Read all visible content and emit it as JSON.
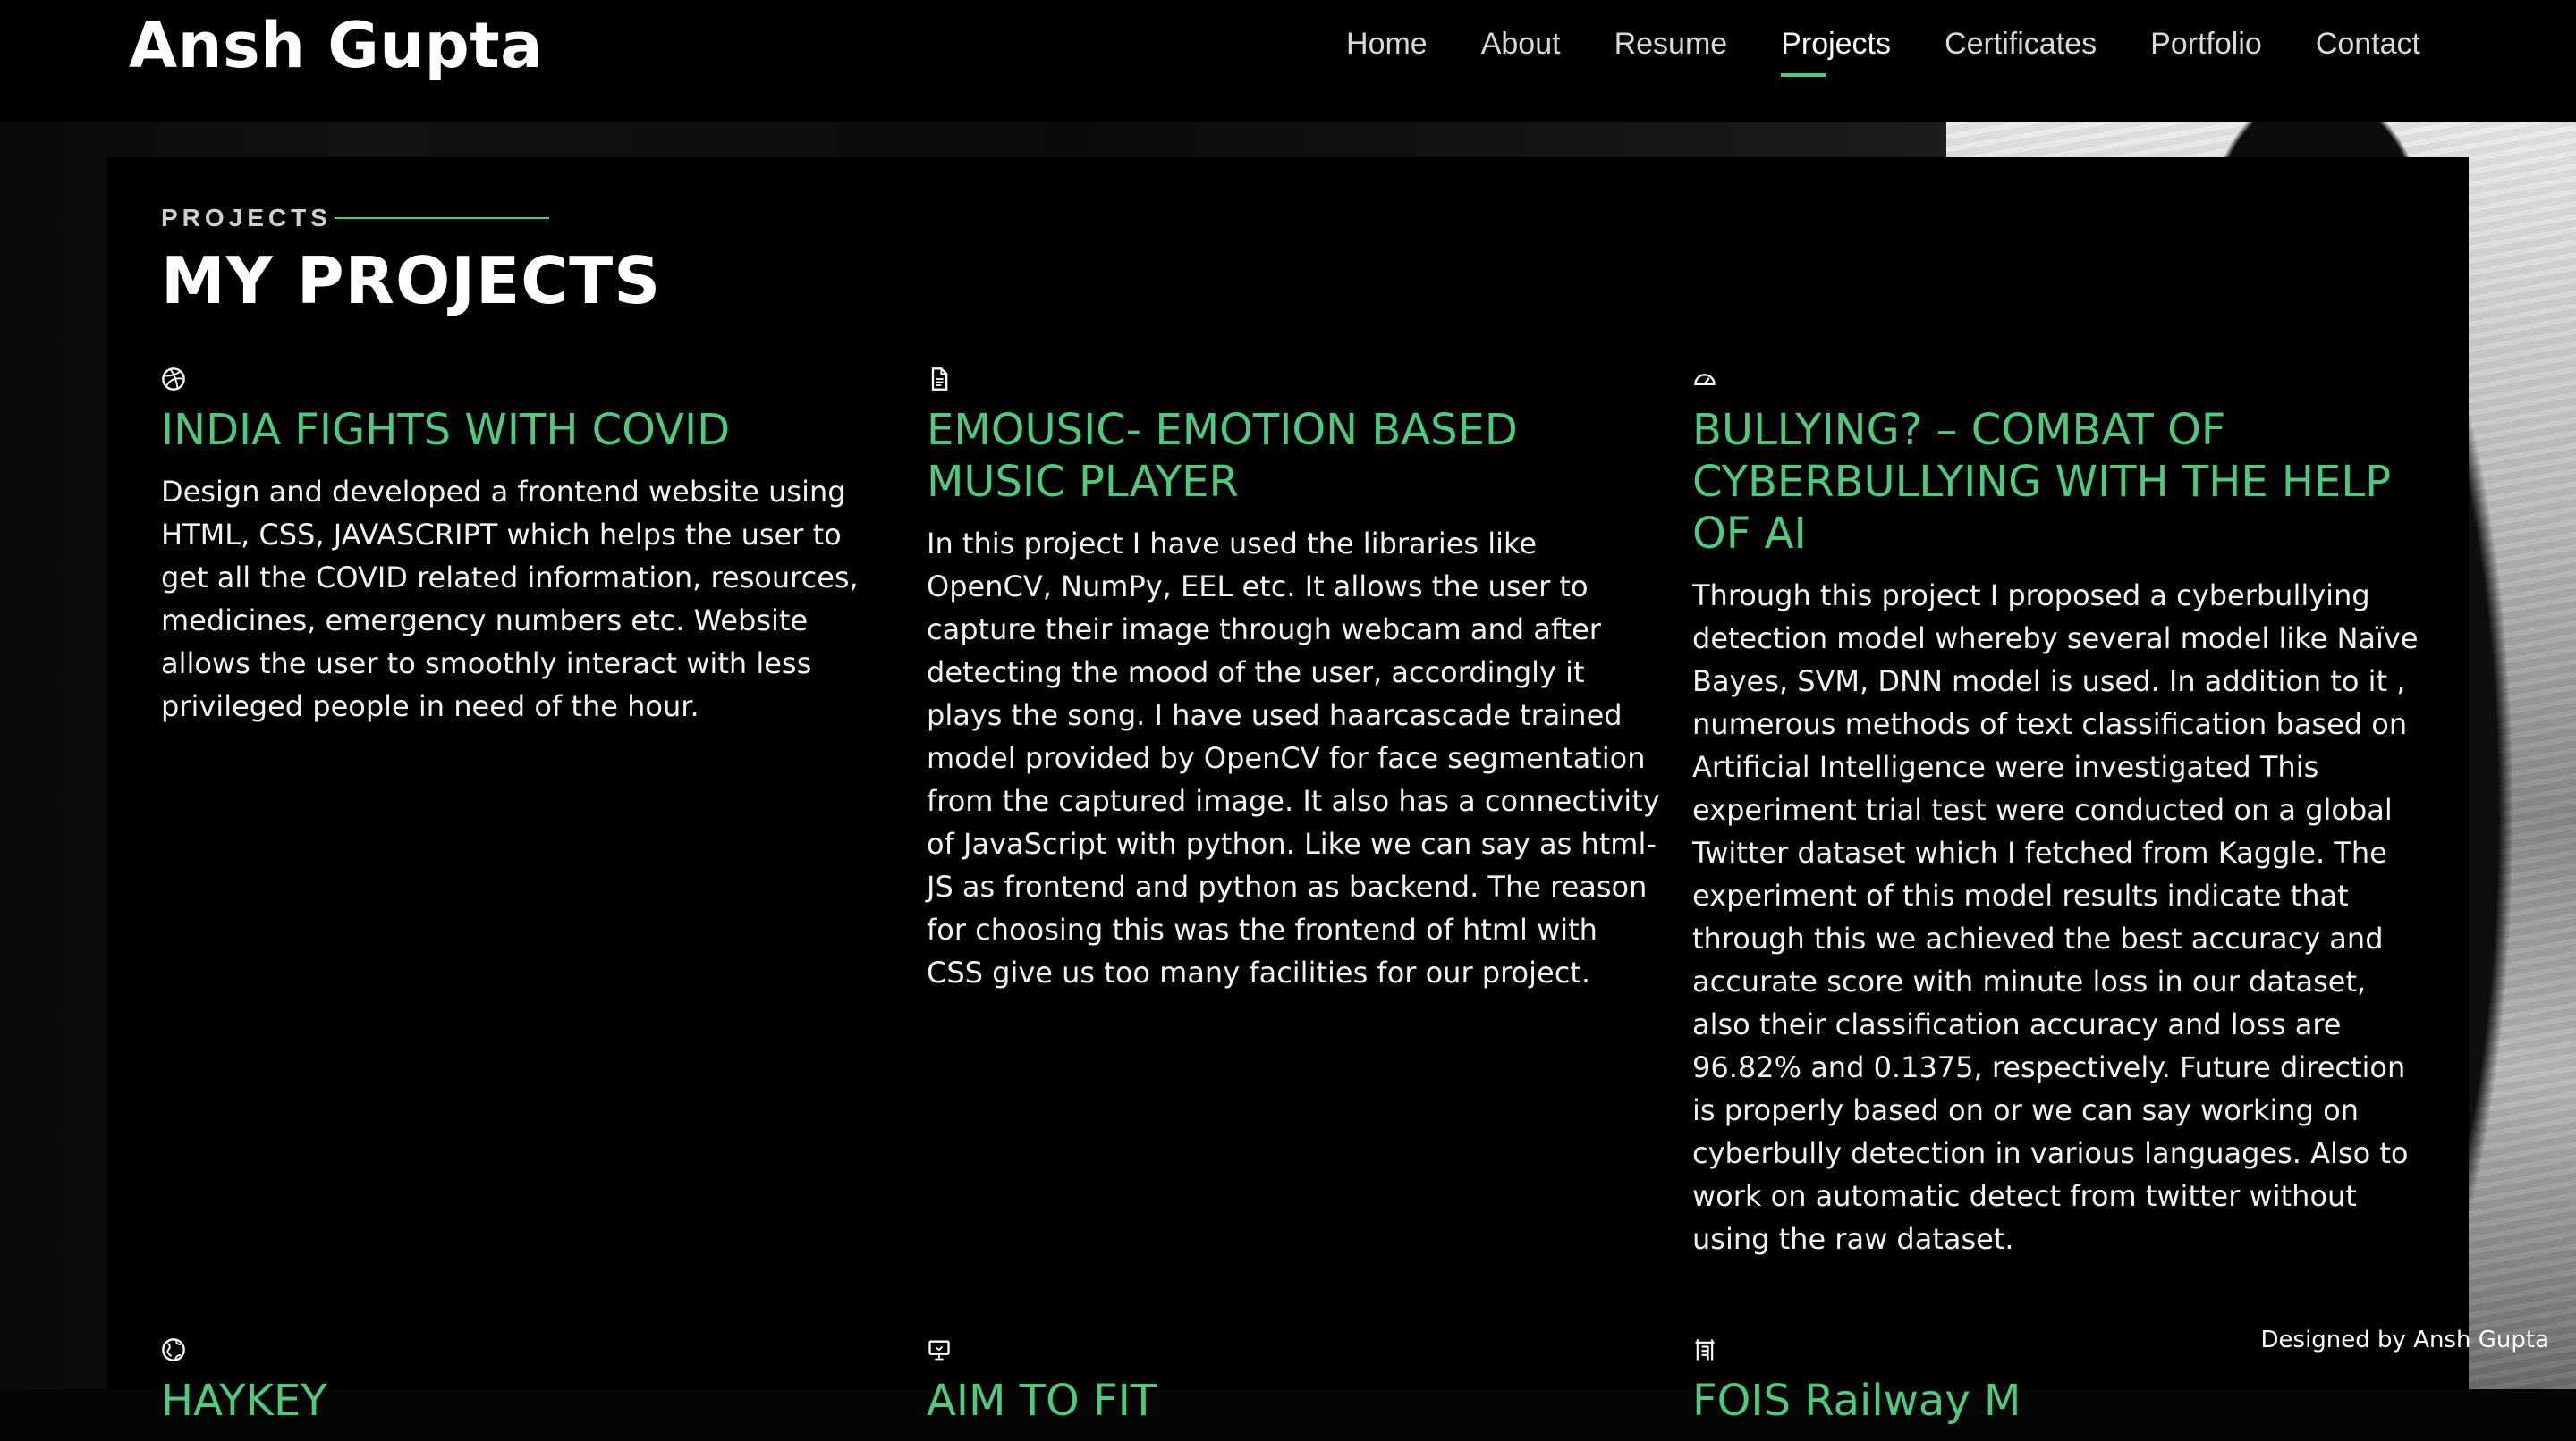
{
  "header": {
    "brand": "Ansh Gupta",
    "nav": [
      {
        "label": "Home"
      },
      {
        "label": "About"
      },
      {
        "label": "Resume"
      },
      {
        "label": "Projects",
        "active": true
      },
      {
        "label": "Certificates"
      },
      {
        "label": "Portfolio"
      },
      {
        "label": "Contact"
      }
    ]
  },
  "section": {
    "label": "PROJECTS",
    "title": "MY PROJECTS"
  },
  "projects": [
    {
      "icon": "dribbble-icon",
      "title": "INDIA FIGHTS WITH COVID",
      "description": "Design and developed a frontend website using HTML, CSS, JAVASCRIPT which helps the user to get all the COVID related information, resources, medicines, emergency numbers etc. Website allows the user to smoothly interact with less privileged people in need of the hour."
    },
    {
      "icon": "file-text-icon",
      "title": "EMOUSIC- EMOTION BASED MUSIC PLAYER",
      "description": "In this project I have used the libraries like OpenCV, NumPy, EEL etc. It allows the user to capture their image through webcam and after detecting the mood of the user, accordingly it plays the song. I have used haarcascade trained model provided by OpenCV for face segmentation from the captured image. It also has a connectivity of JavaScript with python. Like we can say as html-JS as frontend and python as backend. The reason for choosing this was the frontend of html with CSS give us too many facilities for our project."
    },
    {
      "icon": "speedometer-icon",
      "title": "BULLYING? – COMBAT OF CYBERBULLYING WITH THE HELP OF AI",
      "description": "Through this project I proposed a cyberbullying detection model whereby several model like Naïve Bayes, SVM, DNN model is used. In addition to it , numerous methods of text classification based on Artificial Intelligence were investigated This experiment trial test were conducted on a global Twitter dataset which I fetched from Kaggle. The experiment of this model results indicate that through this we achieved the best accuracy and accurate score with minute loss in our dataset, also their classification accuracy and loss are 96.82% and 0.1375, respectively. Future direction is properly based on or we can say working on cyberbully detection in various languages. Also to work on automatic detect from twitter without using the raw dataset."
    },
    {
      "icon": "globe-icon",
      "title": "HAYKEY",
      "description": ""
    },
    {
      "icon": "presentation-icon",
      "title": "AIM TO FIT",
      "description": ""
    },
    {
      "icon": "building-icon",
      "title": "FOIS Railway M",
      "description": ""
    }
  ],
  "footer": {
    "credit": "Designed by Ansh Gupta"
  },
  "colors": {
    "accent": "#4fc97d",
    "background": "#000000",
    "text": "#ffffff"
  }
}
